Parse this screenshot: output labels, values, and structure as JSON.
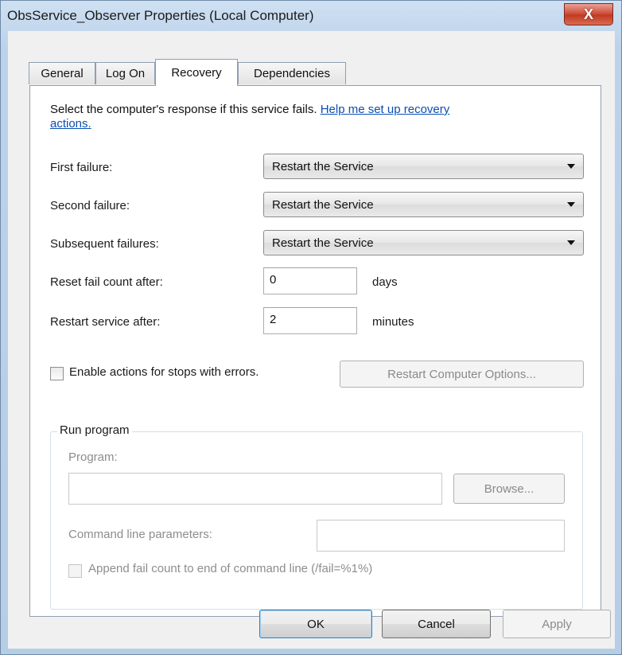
{
  "window": {
    "title": "ObsService_Observer Properties (Local Computer)",
    "close_label": "X"
  },
  "tabs": [
    {
      "label": "General"
    },
    {
      "label": "Log On"
    },
    {
      "label": "Recovery",
      "active": true
    },
    {
      "label": "Dependencies"
    }
  ],
  "recovery": {
    "intro_text": "Select the computer's response if this service fails. ",
    "help_link_line1": "Help me set up recovery",
    "help_link_line2": "actions.",
    "first_failure_label": "First failure:",
    "first_failure_value": "Restart the Service",
    "second_failure_label": "Second failure:",
    "second_failure_value": "Restart the Service",
    "subsequent_failures_label": "Subsequent failures:",
    "subsequent_failures_value": "Restart the Service",
    "reset_label": "Reset fail count after:",
    "reset_value": "0",
    "reset_unit": "days",
    "restart_label": "Restart service after:",
    "restart_value": "2",
    "restart_unit": "minutes",
    "enable_actions_label": "Enable actions for stops with errors.",
    "enable_actions_checked": false,
    "restart_computer_options_label": "Restart Computer Options..."
  },
  "run_program": {
    "group_title": "Run program",
    "program_label": "Program:",
    "program_value": "",
    "browse_label": "Browse...",
    "cmdline_label": "Command line parameters:",
    "cmdline_value": "",
    "append_label": "Append fail count to end of command line (/fail=%1%)",
    "append_checked": false
  },
  "footer": {
    "ok_label": "OK",
    "cancel_label": "Cancel",
    "apply_label": "Apply"
  }
}
